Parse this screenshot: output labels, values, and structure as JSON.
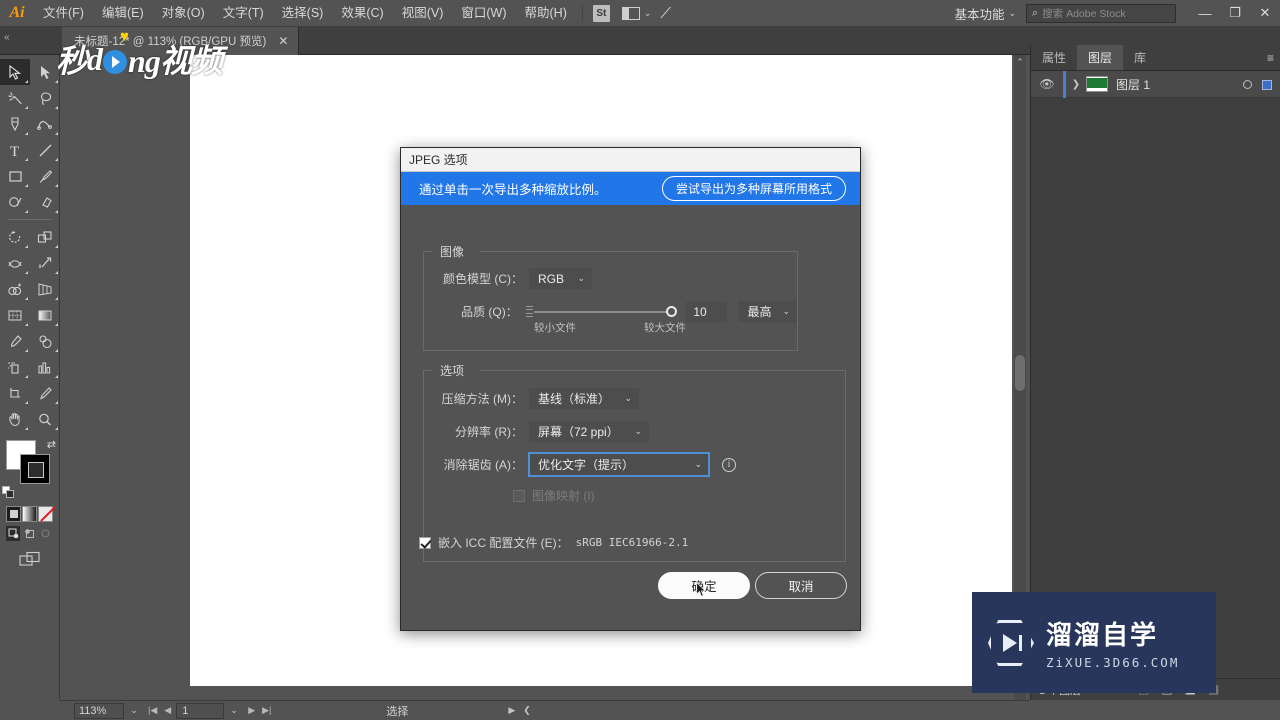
{
  "app": {
    "logo": "Ai",
    "menus": [
      {
        "label": "文件(F)"
      },
      {
        "label": "编辑(E)"
      },
      {
        "label": "对象(O)"
      },
      {
        "label": "文字(T)"
      },
      {
        "label": "选择(S)"
      },
      {
        "label": "效果(C)"
      },
      {
        "label": "视图(V)"
      },
      {
        "label": "窗口(W)"
      },
      {
        "label": "帮助(H)"
      }
    ],
    "stock_badge": "St",
    "workspace": "基本功能",
    "search_placeholder": "搜索 Adobe Stock",
    "window_controls": {
      "minimize": "—",
      "restore": "❐",
      "close": "✕"
    }
  },
  "tabbar": {
    "collapse": "«",
    "document": {
      "title": "未标题-12* @ 113% (RGB/GPU 预览)",
      "close": "✕"
    }
  },
  "toolbar": {
    "tools": [
      {
        "name": "selection-tool",
        "selected": true
      },
      {
        "name": "direct-selection-tool",
        "selected": false
      },
      {
        "name": "magic-wand-tool",
        "selected": false
      },
      {
        "name": "lasso-tool",
        "selected": false
      },
      {
        "name": "pen-tool",
        "selected": false
      },
      {
        "name": "curvature-tool",
        "selected": false
      },
      {
        "name": "type-tool",
        "selected": false
      },
      {
        "name": "line-segment-tool",
        "selected": false
      },
      {
        "name": "rectangle-tool",
        "selected": false
      },
      {
        "name": "paintbrush-tool",
        "selected": false
      },
      {
        "name": "shaper-tool",
        "selected": false
      },
      {
        "name": "eraser-tool",
        "selected": false
      },
      {
        "name": "rotate-tool",
        "selected": false
      },
      {
        "name": "scale-tool",
        "selected": false
      },
      {
        "name": "width-tool",
        "selected": false
      },
      {
        "name": "free-transform-tool",
        "selected": false
      },
      {
        "name": "shape-builder-tool",
        "selected": false
      },
      {
        "name": "perspective-grid-tool",
        "selected": false
      },
      {
        "name": "mesh-tool",
        "selected": false
      },
      {
        "name": "gradient-tool",
        "selected": false
      },
      {
        "name": "eyedropper-tool",
        "selected": false
      },
      {
        "name": "blend-tool",
        "selected": false
      },
      {
        "name": "symbol-sprayer-tool",
        "selected": false
      },
      {
        "name": "column-graph-tool",
        "selected": false
      },
      {
        "name": "artboard-tool",
        "selected": false
      },
      {
        "name": "slice-tool",
        "selected": false
      },
      {
        "name": "hand-tool",
        "selected": false
      },
      {
        "name": "zoom-tool",
        "selected": false
      }
    ],
    "fill_color": "#ffffff",
    "stroke_color": "#000000",
    "swap_glyph": "⇄"
  },
  "right_panel": {
    "tabs": [
      {
        "label": "属性",
        "active": false
      },
      {
        "label": "图层",
        "active": true
      },
      {
        "label": "库",
        "active": false
      }
    ],
    "menu_glyph": "≡",
    "layers": [
      {
        "name": "图层 1",
        "visible": true,
        "thumb_color": "#1e7a35",
        "target_selected": true
      }
    ],
    "footer": {
      "count": "1 个图层"
    }
  },
  "statusbar": {
    "zoom": "113%",
    "page": "1",
    "tool": "选择"
  },
  "dialog": {
    "title": "JPEG 选项",
    "banner": {
      "text": "通过单击一次导出多种缩放比例。",
      "button": "尝试导出为多种屏幕所用格式"
    },
    "image_group": {
      "legend": "图像",
      "color_model": {
        "label": "颜色模型 (C)：",
        "value": "RGB"
      },
      "quality": {
        "label": "品质 (Q)：",
        "number": "10",
        "preset": "最高",
        "slider_percent": 100,
        "hint_small": "较小文件",
        "hint_large": "较大文件"
      }
    },
    "options_group": {
      "legend": "选项",
      "compression": {
        "label": "压缩方法 (M)：",
        "value": "基线（标准）"
      },
      "resolution": {
        "label": "分辨率 (R)：",
        "value": "屏幕（72 ppi）"
      },
      "antialias": {
        "label": "消除锯齿 (A)：",
        "value": "优化文字（提示）",
        "focused": true,
        "info_glyph": "i"
      },
      "image_map": {
        "label": "图像映射 (I)",
        "checked": false,
        "disabled": true
      }
    },
    "icc": {
      "label": "嵌入 ICC 配置文件 (E)：",
      "value": "sRGB IEC61966-2.1",
      "checked": true
    },
    "buttons": {
      "ok": "确定",
      "cancel": "取消"
    }
  },
  "watermarks": {
    "top_left": {
      "text_a": "秒",
      "text_b": "ng视频",
      "dot_letter": "d",
      "accent": "#2f8fe0"
    },
    "bottom_right": {
      "title": "溜溜自学",
      "subtitle": "ZiXUE.3D66.COM",
      "bg": "#28365c"
    }
  }
}
